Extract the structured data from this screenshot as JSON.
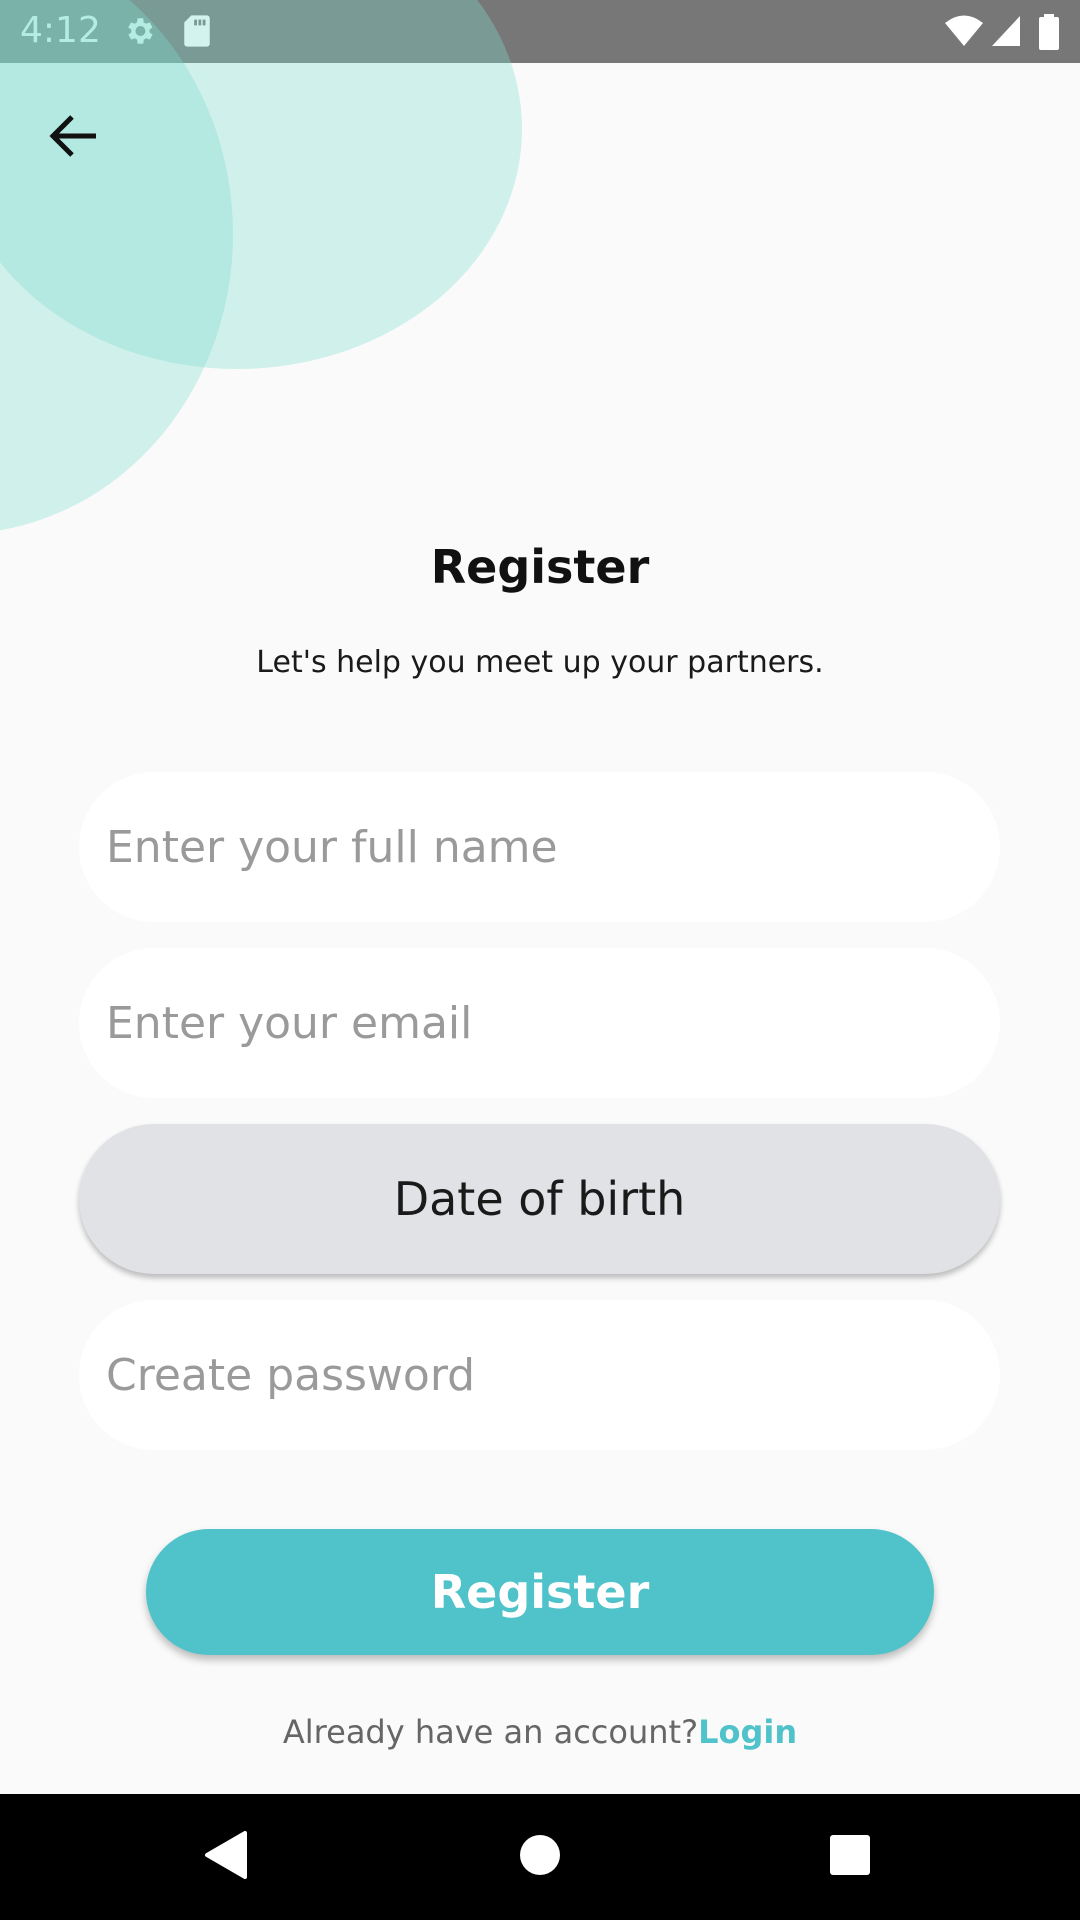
{
  "status_bar": {
    "time": "4:12",
    "icons": [
      "settings-icon",
      "sd-card-icon",
      "wifi-icon",
      "signal-icon",
      "battery-icon"
    ]
  },
  "header": {
    "back_icon": "arrow-left-icon"
  },
  "title": "Register",
  "subtitle": "Let's help you meet up your partners.",
  "form": {
    "full_name": {
      "value": "",
      "placeholder": "Enter your full name"
    },
    "email": {
      "value": "",
      "placeholder": "Enter your email"
    },
    "dob_label": "Date of birth",
    "password": {
      "value": "",
      "placeholder": "Create password"
    }
  },
  "register_label": "Register",
  "login_prompt": "Already have an account?",
  "login_link": "Login",
  "nav_bar": {
    "icons": [
      "back-triangle-icon",
      "home-circle-icon",
      "recents-square-icon"
    ]
  },
  "colors": {
    "accent": "#50c2ca",
    "circle": "#7fdccd",
    "status_bar": "#777777",
    "background": "#fafafa",
    "dob_background": "#e0e2e5"
  }
}
